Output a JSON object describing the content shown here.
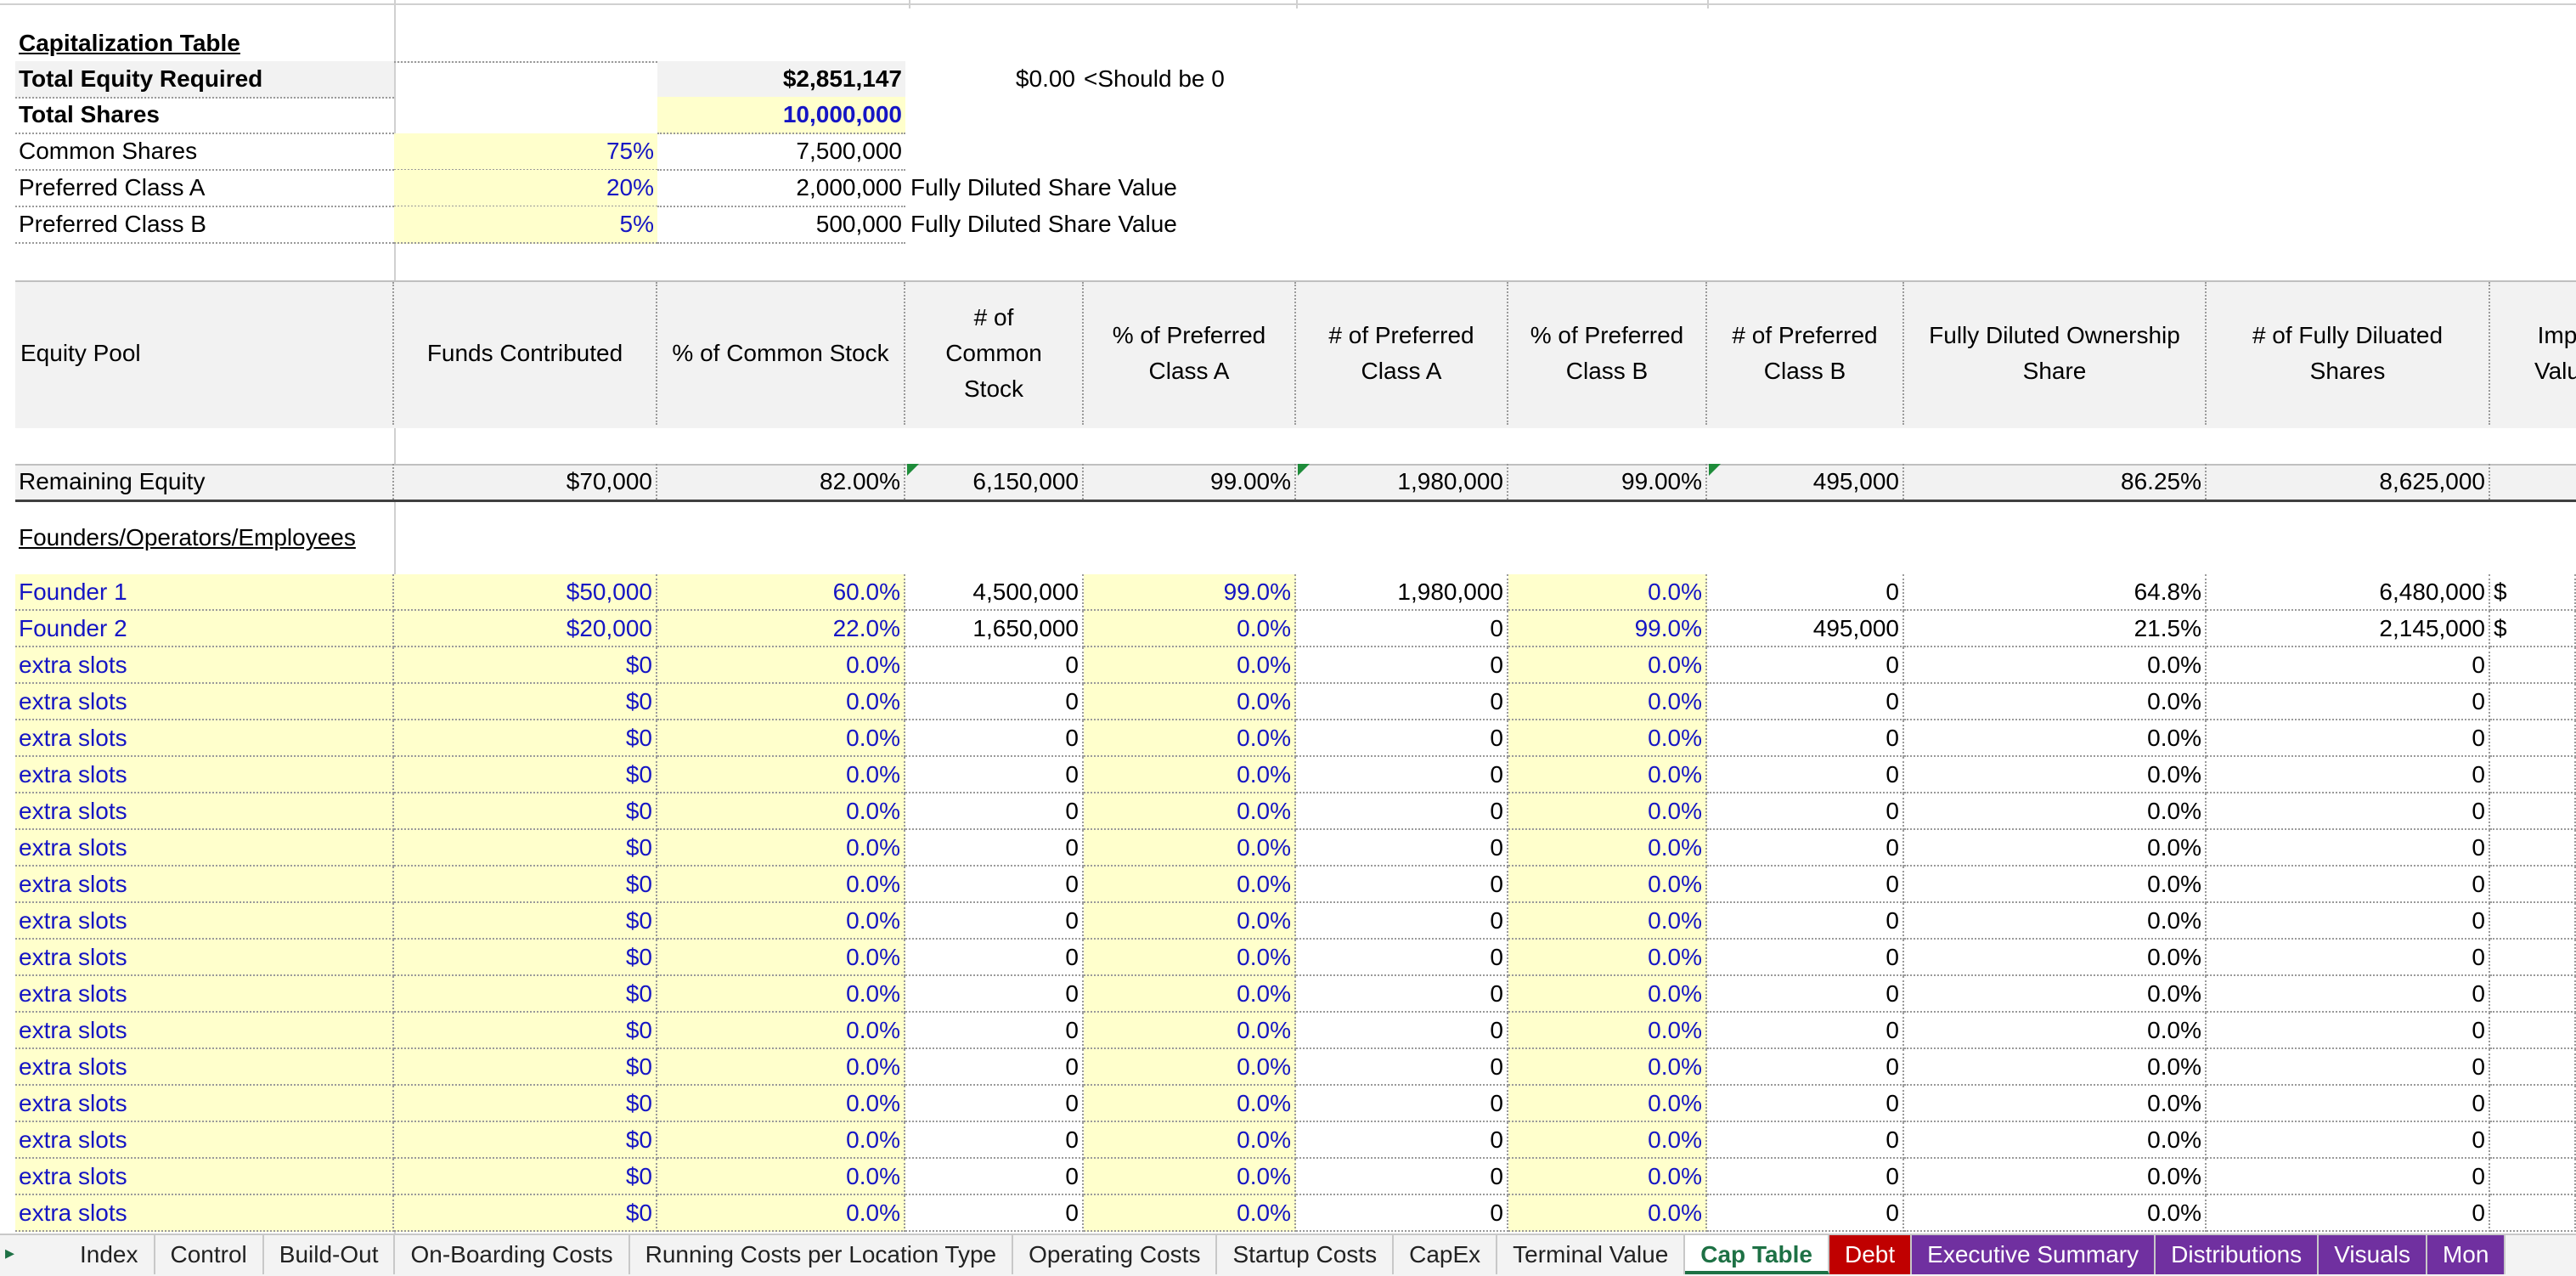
{
  "summary": {
    "title": "Capitalization Table",
    "total_equity_label": "Total Equity Required",
    "total_equity_value": "$2,851,147",
    "check_value": "$0.00",
    "check_note": "<Should be 0",
    "total_shares_label": "Total Shares",
    "total_shares_value": "10,000,000",
    "common_label": "Common Shares",
    "common_pct": "75%",
    "common_shares": "7,500,000",
    "prefA_label": "Preferred Class A",
    "prefA_pct": "20%",
    "prefA_shares": "2,000,000",
    "prefA_note": "Fully Diluted Share Value",
    "prefB_label": "Preferred Class B",
    "prefB_pct": "5%",
    "prefB_shares": "500,000",
    "prefB_note": "Fully Diluted Share Value"
  },
  "headers": {
    "equity_pool": "Equity Pool",
    "funds_contributed": "Funds Contributed",
    "pct_common": "% of Common Stock",
    "num_common": "# of Common Stock",
    "pct_prefA": "% of Preferred Class A",
    "num_prefA": "# of Preferred Class A",
    "pct_prefB": "% of Preferred Class B",
    "num_prefB": "# of Preferred Class B",
    "fd_share": "Fully Diluted Ownership Share",
    "fd_shares": "# of Fully Diluated Shares",
    "implied": "Imp Valu"
  },
  "remaining": {
    "label": "Remaining Equity",
    "funds": "$70,000",
    "pct_common": "82.00%",
    "num_common": "6,150,000",
    "pct_prefA": "99.00%",
    "num_prefA": "1,980,000",
    "pct_prefB": "99.00%",
    "num_prefB": "495,000",
    "fd_share": "86.25%",
    "fd_shares": "8,625,000"
  },
  "section_label": "Founders/Operators/Employees",
  "rows": [
    {
      "name": "Founder 1",
      "funds": "$50,000",
      "pct_common": "60.0%",
      "num_common": "4,500,000",
      "pct_prefA": "99.0%",
      "num_prefA": "1,980,000",
      "pct_prefB": "0.0%",
      "num_prefB": "0",
      "fd_share": "64.8%",
      "fd_shares": "6,480,000",
      "implied": "$"
    },
    {
      "name": "Founder 2",
      "funds": "$20,000",
      "pct_common": "22.0%",
      "num_common": "1,650,000",
      "pct_prefA": "0.0%",
      "num_prefA": "0",
      "pct_prefB": "99.0%",
      "num_prefB": "495,000",
      "fd_share": "21.5%",
      "fd_shares": "2,145,000",
      "implied": "$"
    },
    {
      "name": "extra slots",
      "funds": "$0",
      "pct_common": "0.0%",
      "num_common": "0",
      "pct_prefA": "0.0%",
      "num_prefA": "0",
      "pct_prefB": "0.0%",
      "num_prefB": "0",
      "fd_share": "0.0%",
      "fd_shares": "0",
      "implied": ""
    },
    {
      "name": "extra slots",
      "funds": "$0",
      "pct_common": "0.0%",
      "num_common": "0",
      "pct_prefA": "0.0%",
      "num_prefA": "0",
      "pct_prefB": "0.0%",
      "num_prefB": "0",
      "fd_share": "0.0%",
      "fd_shares": "0",
      "implied": ""
    },
    {
      "name": "extra slots",
      "funds": "$0",
      "pct_common": "0.0%",
      "num_common": "0",
      "pct_prefA": "0.0%",
      "num_prefA": "0",
      "pct_prefB": "0.0%",
      "num_prefB": "0",
      "fd_share": "0.0%",
      "fd_shares": "0",
      "implied": ""
    },
    {
      "name": "extra slots",
      "funds": "$0",
      "pct_common": "0.0%",
      "num_common": "0",
      "pct_prefA": "0.0%",
      "num_prefA": "0",
      "pct_prefB": "0.0%",
      "num_prefB": "0",
      "fd_share": "0.0%",
      "fd_shares": "0",
      "implied": ""
    },
    {
      "name": "extra slots",
      "funds": "$0",
      "pct_common": "0.0%",
      "num_common": "0",
      "pct_prefA": "0.0%",
      "num_prefA": "0",
      "pct_prefB": "0.0%",
      "num_prefB": "0",
      "fd_share": "0.0%",
      "fd_shares": "0",
      "implied": ""
    },
    {
      "name": "extra slots",
      "funds": "$0",
      "pct_common": "0.0%",
      "num_common": "0",
      "pct_prefA": "0.0%",
      "num_prefA": "0",
      "pct_prefB": "0.0%",
      "num_prefB": "0",
      "fd_share": "0.0%",
      "fd_shares": "0",
      "implied": ""
    },
    {
      "name": "extra slots",
      "funds": "$0",
      "pct_common": "0.0%",
      "num_common": "0",
      "pct_prefA": "0.0%",
      "num_prefA": "0",
      "pct_prefB": "0.0%",
      "num_prefB": "0",
      "fd_share": "0.0%",
      "fd_shares": "0",
      "implied": ""
    },
    {
      "name": "extra slots",
      "funds": "$0",
      "pct_common": "0.0%",
      "num_common": "0",
      "pct_prefA": "0.0%",
      "num_prefA": "0",
      "pct_prefB": "0.0%",
      "num_prefB": "0",
      "fd_share": "0.0%",
      "fd_shares": "0",
      "implied": ""
    },
    {
      "name": "extra slots",
      "funds": "$0",
      "pct_common": "0.0%",
      "num_common": "0",
      "pct_prefA": "0.0%",
      "num_prefA": "0",
      "pct_prefB": "0.0%",
      "num_prefB": "0",
      "fd_share": "0.0%",
      "fd_shares": "0",
      "implied": ""
    },
    {
      "name": "extra slots",
      "funds": "$0",
      "pct_common": "0.0%",
      "num_common": "0",
      "pct_prefA": "0.0%",
      "num_prefA": "0",
      "pct_prefB": "0.0%",
      "num_prefB": "0",
      "fd_share": "0.0%",
      "fd_shares": "0",
      "implied": ""
    },
    {
      "name": "extra slots",
      "funds": "$0",
      "pct_common": "0.0%",
      "num_common": "0",
      "pct_prefA": "0.0%",
      "num_prefA": "0",
      "pct_prefB": "0.0%",
      "num_prefB": "0",
      "fd_share": "0.0%",
      "fd_shares": "0",
      "implied": ""
    },
    {
      "name": "extra slots",
      "funds": "$0",
      "pct_common": "0.0%",
      "num_common": "0",
      "pct_prefA": "0.0%",
      "num_prefA": "0",
      "pct_prefB": "0.0%",
      "num_prefB": "0",
      "fd_share": "0.0%",
      "fd_shares": "0",
      "implied": ""
    },
    {
      "name": "extra slots",
      "funds": "$0",
      "pct_common": "0.0%",
      "num_common": "0",
      "pct_prefA": "0.0%",
      "num_prefA": "0",
      "pct_prefB": "0.0%",
      "num_prefB": "0",
      "fd_share": "0.0%",
      "fd_shares": "0",
      "implied": ""
    },
    {
      "name": "extra slots",
      "funds": "$0",
      "pct_common": "0.0%",
      "num_common": "0",
      "pct_prefA": "0.0%",
      "num_prefA": "0",
      "pct_prefB": "0.0%",
      "num_prefB": "0",
      "fd_share": "0.0%",
      "fd_shares": "0",
      "implied": ""
    },
    {
      "name": "extra slots",
      "funds": "$0",
      "pct_common": "0.0%",
      "num_common": "0",
      "pct_prefA": "0.0%",
      "num_prefA": "0",
      "pct_prefB": "0.0%",
      "num_prefB": "0",
      "fd_share": "0.0%",
      "fd_shares": "0",
      "implied": ""
    },
    {
      "name": "extra slots",
      "funds": "$0",
      "pct_common": "0.0%",
      "num_common": "0",
      "pct_prefA": "0.0%",
      "num_prefA": "0",
      "pct_prefB": "0.0%",
      "num_prefB": "0",
      "fd_share": "0.0%",
      "fd_shares": "0",
      "implied": ""
    }
  ],
  "tabs": [
    {
      "label": "Index",
      "style": "normal"
    },
    {
      "label": "Control",
      "style": "normal"
    },
    {
      "label": "Build-Out",
      "style": "normal"
    },
    {
      "label": "On-Boarding Costs",
      "style": "normal"
    },
    {
      "label": "Running Costs per Location Type",
      "style": "normal"
    },
    {
      "label": "Operating Costs",
      "style": "normal"
    },
    {
      "label": "Startup Costs",
      "style": "normal"
    },
    {
      "label": "CapEx",
      "style": "normal"
    },
    {
      "label": "Terminal Value",
      "style": "normal"
    },
    {
      "label": "Cap Table",
      "style": "active"
    },
    {
      "label": "Debt",
      "style": "red"
    },
    {
      "label": "Executive Summary",
      "style": "purple"
    },
    {
      "label": "Distributions",
      "style": "purple"
    },
    {
      "label": "Visuals",
      "style": "purple"
    },
    {
      "label": "Mon",
      "style": "purple"
    }
  ]
}
